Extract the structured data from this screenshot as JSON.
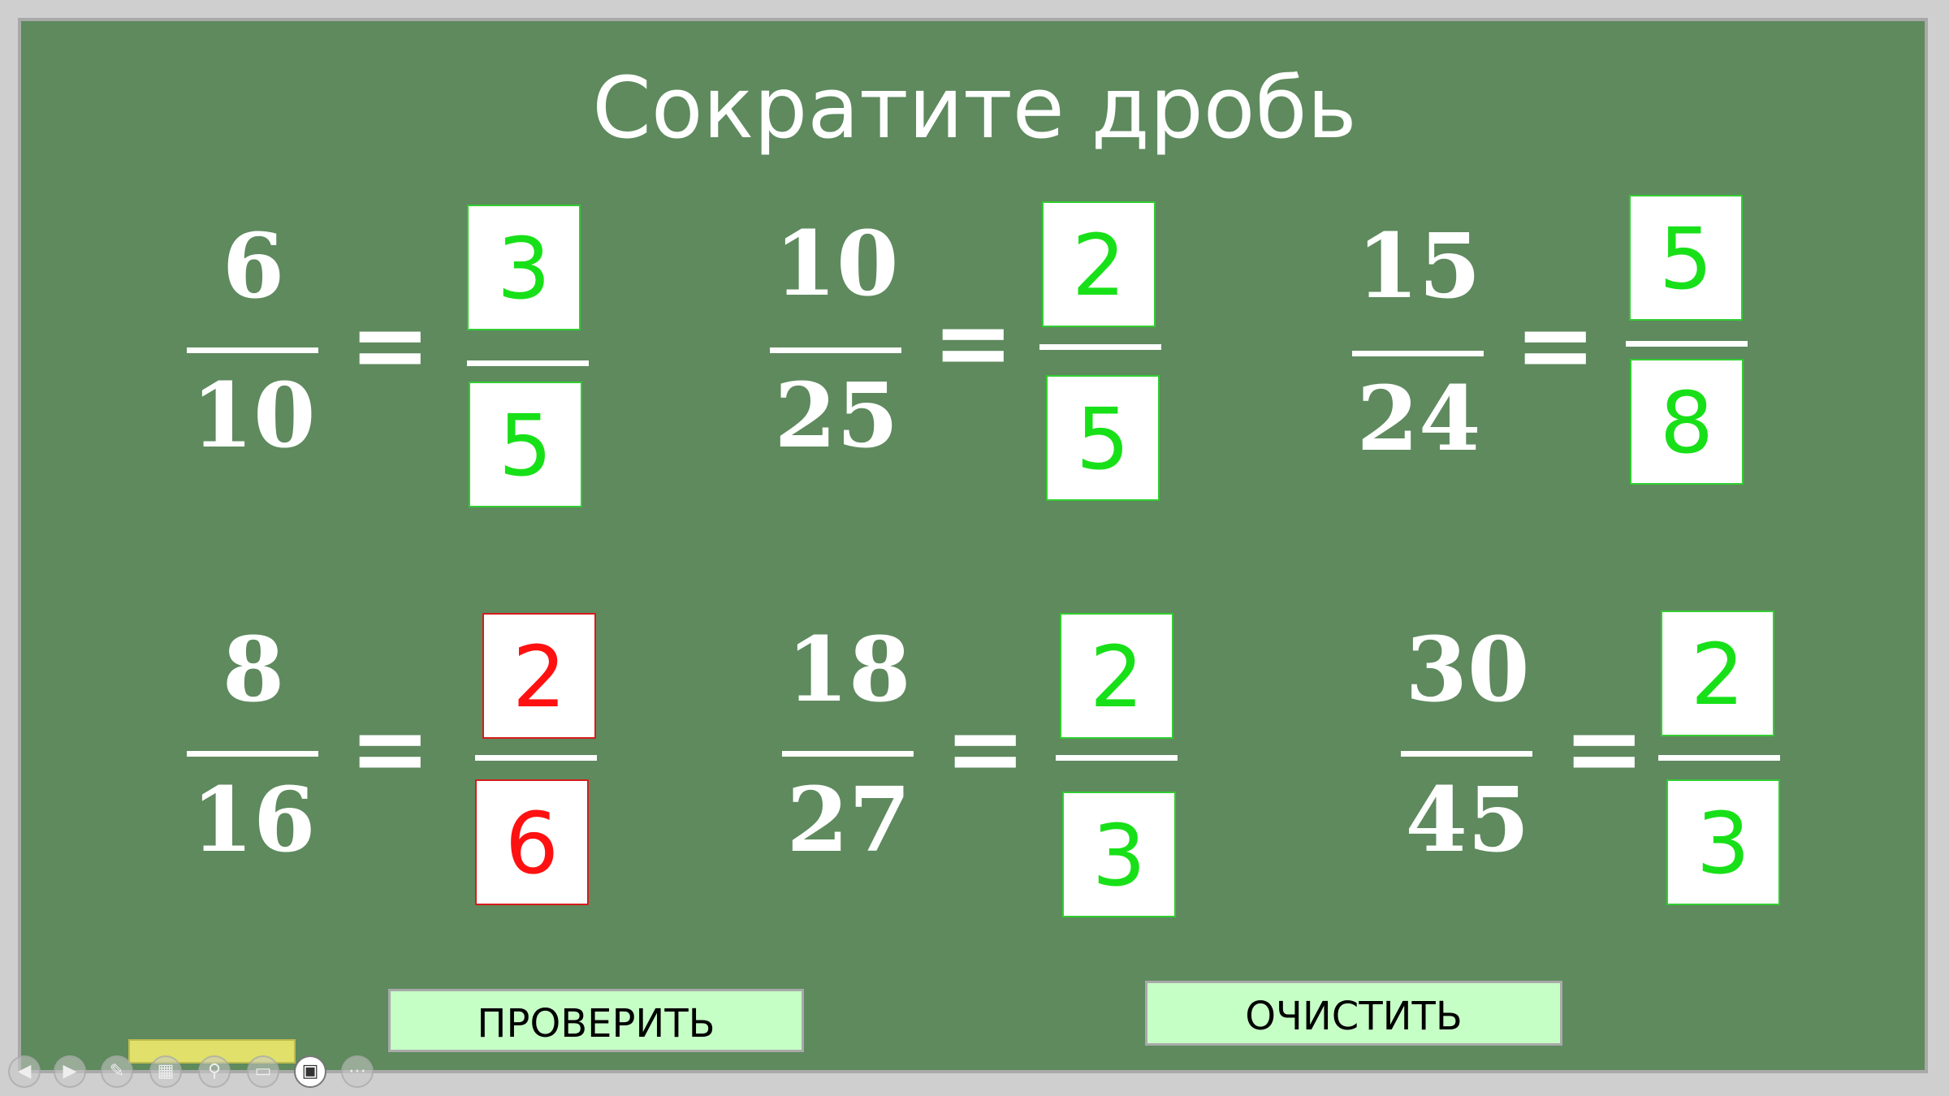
{
  "title": "Сократите дробь",
  "equals_sign": "=",
  "fractions": [
    {
      "num": "6",
      "den": "10",
      "ans_num": "3",
      "ans_den": "5",
      "num_status": "correct",
      "den_status": "correct"
    },
    {
      "num": "10",
      "den": "25",
      "ans_num": "2",
      "ans_den": "5",
      "num_status": "correct",
      "den_status": "correct"
    },
    {
      "num": "15",
      "den": "24",
      "ans_num": "5",
      "ans_den": "8",
      "num_status": "correct",
      "den_status": "correct"
    },
    {
      "num": "8",
      "den": "16",
      "ans_num": "2",
      "ans_den": "6",
      "num_status": "incorrect",
      "den_status": "incorrect"
    },
    {
      "num": "18",
      "den": "27",
      "ans_num": "2",
      "ans_den": "3",
      "num_status": "correct",
      "den_status": "correct"
    },
    {
      "num": "30",
      "den": "45",
      "ans_num": "2",
      "ans_den": "3",
      "num_status": "correct",
      "den_status": "correct"
    }
  ],
  "buttons": {
    "check": "ПРОВЕРИТЬ",
    "clear": "ОЧИСТИТЬ"
  },
  "toolbar_icons": [
    "back-icon",
    "play-icon",
    "pen-icon",
    "slides-icon",
    "zoom-icon",
    "subtitles-icon",
    "camera-icon",
    "more-icon"
  ],
  "colors": {
    "board": "#5e8a5e",
    "correct": "#18e018",
    "incorrect": "#ff1111",
    "button": "#c6ffc6"
  }
}
